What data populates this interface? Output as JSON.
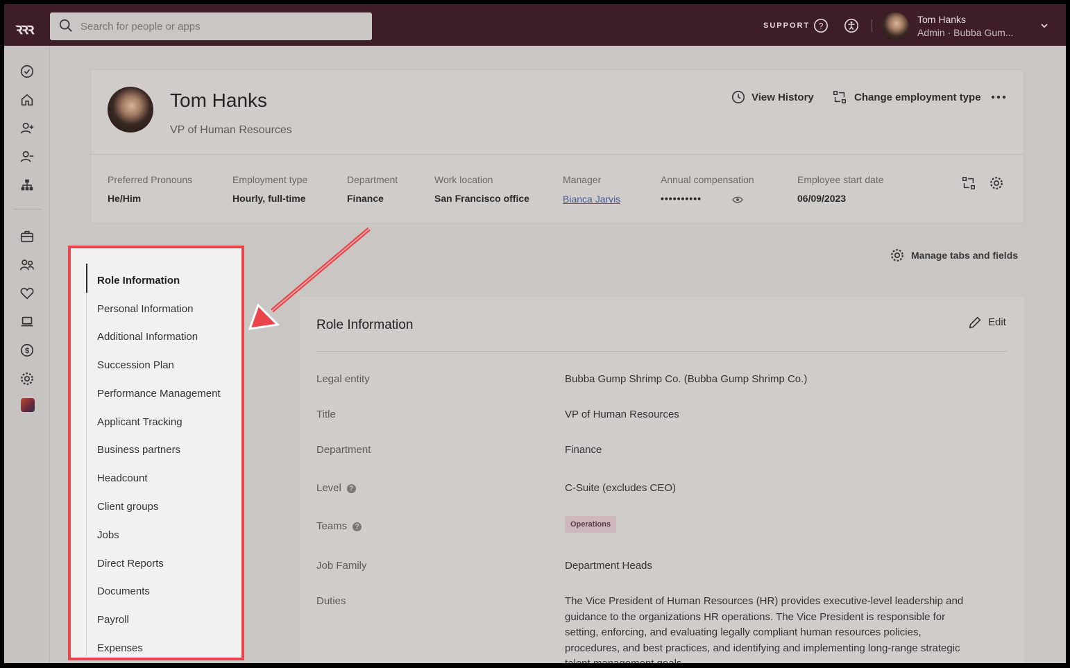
{
  "topbar": {
    "logo": "ꝛꝛꝛ",
    "search_placeholder": "Search for people or apps",
    "support_label": "SUPPORT",
    "user_name": "Tom Hanks",
    "user_role": "Admin · Bubba Gum..."
  },
  "rail": {
    "icons": [
      "check-circle-icon",
      "home-icon",
      "add-person-icon",
      "remove-person-icon",
      "org-chart-icon",
      "briefcase-icon",
      "people-icon",
      "heart-icon",
      "laptop-icon",
      "dollar-icon",
      "settings-icon",
      "app-tile-icon"
    ]
  },
  "profile": {
    "name": "Tom Hanks",
    "title": "VP of Human Resources",
    "view_history": "View History",
    "change_employment": "Change employment type",
    "fields": [
      {
        "label": "Preferred Pronouns",
        "value": "He/Him"
      },
      {
        "label": "Employment type",
        "value": "Hourly, full-time"
      },
      {
        "label": "Department",
        "value": "Finance"
      },
      {
        "label": "Work location",
        "value": "San Francisco office"
      },
      {
        "label": "Manager",
        "value": "Bianca Jarvis"
      },
      {
        "label": "Annual compensation",
        "value": "••••••••••"
      },
      {
        "label": "Employee start date",
        "value": "06/09/2023"
      }
    ]
  },
  "manage_tabs_label": "Manage tabs and fields",
  "tabs": [
    "Role Information",
    "Personal Information",
    "Additional Information",
    "Succession Plan",
    "Performance Management",
    "Applicant Tracking",
    "Business partners",
    "Headcount",
    "Client groups",
    "Jobs",
    "Direct Reports",
    "Documents",
    "Payroll",
    "Expenses"
  ],
  "role_info": {
    "title": "Role Information",
    "edit_label": "Edit",
    "rows": [
      {
        "label": "Legal entity",
        "value": "Bubba Gump Shrimp Co. (Bubba Gump Shrimp Co.)"
      },
      {
        "label": "Title",
        "value": "VP of Human Resources"
      },
      {
        "label": "Department",
        "value": "Finance"
      },
      {
        "label": "Level",
        "value": "C-Suite (excludes CEO)"
      },
      {
        "label": "Teams",
        "value": "Operations"
      },
      {
        "label": "Job Family",
        "value": "Department Heads"
      },
      {
        "label": "Duties",
        "value": "The Vice President of Human Resources (HR) provides executive-level leadership and guidance to the organizations HR operations. The Vice President is responsible for setting, enforcing, and evaluating legally compliant human resources policies, procedures, and best practices, and identifying and implementing long-range strategic talent management goals."
      }
    ]
  },
  "colors": {
    "topbar": "#3d1e28",
    "highlight": "#e9454b",
    "background": "#c9c6c3"
  }
}
